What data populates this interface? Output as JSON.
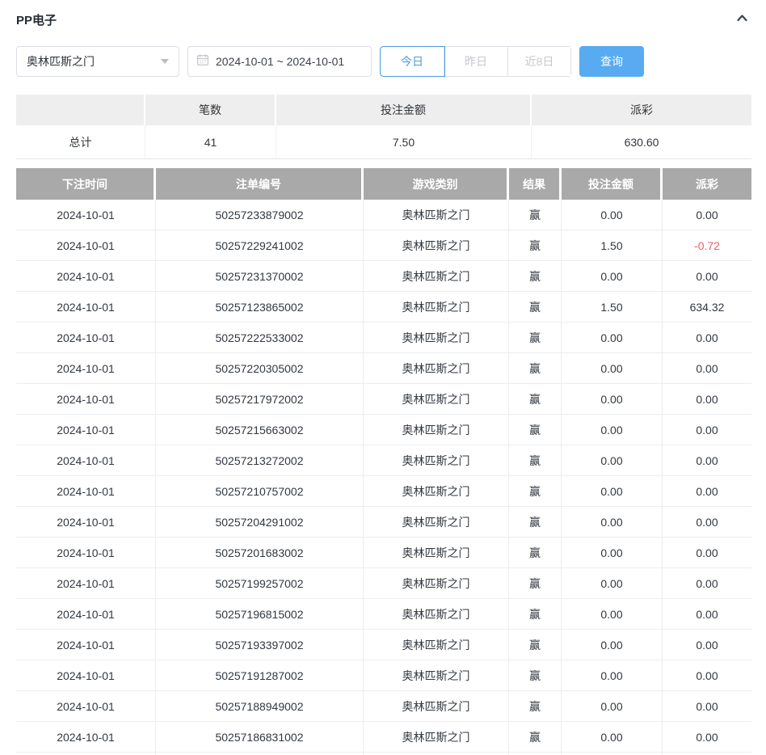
{
  "panel": {
    "title": "PP电子",
    "collapse_icon": "chevron-up-icon"
  },
  "filters": {
    "game_select_value": "奥林匹斯之门",
    "date_range_value": "2024-10-01 ~ 2024-10-01",
    "quick_ranges": [
      {
        "label": "今日",
        "active": true
      },
      {
        "label": "昨日",
        "active": false
      },
      {
        "label": "近8日",
        "active": false
      }
    ],
    "query_button_label": "查询"
  },
  "summary": {
    "headers": [
      "",
      "笔数",
      "投注金额",
      "派彩"
    ],
    "total_row": [
      "总计",
      "41",
      "7.50",
      "630.60"
    ]
  },
  "table": {
    "headers": [
      "下注时间",
      "注单编号",
      "游戏类别",
      "结果",
      "投注金额",
      "派彩"
    ],
    "rows": [
      [
        "2024-10-01",
        "50257233879002",
        "奥林匹斯之门",
        "赢",
        "0.00",
        "0.00"
      ],
      [
        "2024-10-01",
        "50257229241002",
        "奥林匹斯之门",
        "赢",
        "1.50",
        "-0.72"
      ],
      [
        "2024-10-01",
        "50257231370002",
        "奥林匹斯之门",
        "赢",
        "0.00",
        "0.00"
      ],
      [
        "2024-10-01",
        "50257123865002",
        "奥林匹斯之门",
        "赢",
        "1.50",
        "634.32"
      ],
      [
        "2024-10-01",
        "50257222533002",
        "奥林匹斯之门",
        "赢",
        "0.00",
        "0.00"
      ],
      [
        "2024-10-01",
        "50257220305002",
        "奥林匹斯之门",
        "赢",
        "0.00",
        "0.00"
      ],
      [
        "2024-10-01",
        "50257217972002",
        "奥林匹斯之门",
        "赢",
        "0.00",
        "0.00"
      ],
      [
        "2024-10-01",
        "50257215663002",
        "奥林匹斯之门",
        "赢",
        "0.00",
        "0.00"
      ],
      [
        "2024-10-01",
        "50257213272002",
        "奥林匹斯之门",
        "赢",
        "0.00",
        "0.00"
      ],
      [
        "2024-10-01",
        "50257210757002",
        "奥林匹斯之门",
        "赢",
        "0.00",
        "0.00"
      ],
      [
        "2024-10-01",
        "50257204291002",
        "奥林匹斯之门",
        "赢",
        "0.00",
        "0.00"
      ],
      [
        "2024-10-01",
        "50257201683002",
        "奥林匹斯之门",
        "赢",
        "0.00",
        "0.00"
      ],
      [
        "2024-10-01",
        "50257199257002",
        "奥林匹斯之门",
        "赢",
        "0.00",
        "0.00"
      ],
      [
        "2024-10-01",
        "50257196815002",
        "奥林匹斯之门",
        "赢",
        "0.00",
        "0.00"
      ],
      [
        "2024-10-01",
        "50257193397002",
        "奥林匹斯之门",
        "赢",
        "0.00",
        "0.00"
      ],
      [
        "2024-10-01",
        "50257191287002",
        "奥林匹斯之门",
        "赢",
        "0.00",
        "0.00"
      ],
      [
        "2024-10-01",
        "50257188949002",
        "奥林匹斯之门",
        "赢",
        "0.00",
        "0.00"
      ],
      [
        "2024-10-01",
        "50257186831002",
        "奥林匹斯之门",
        "赢",
        "0.00",
        "0.00"
      ]
    ]
  },
  "colors": {
    "accent": "#58abf0",
    "active_blue": "#4f9ae0",
    "negative": "#f15b6c",
    "table_header_gray": "#a9a9a9",
    "summary_header_gray": "#eeeeee"
  }
}
